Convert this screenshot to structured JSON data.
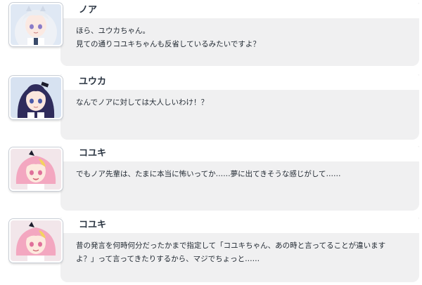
{
  "messages": [
    {
      "speaker": "ノア",
      "lines": [
        "ほら、ユウカちゃん。",
        "見ての通りコユキちゃんも反省しているみたいですよ？"
      ],
      "avatar": "noa-portrait",
      "hair_color": "#e9edf3",
      "accent_color": "#b9c7e6"
    },
    {
      "speaker": "ユウカ",
      "lines": [
        "なんでノアに対しては大人しいわけ！？"
      ],
      "avatar": "yuuka-portrait",
      "hair_color": "#2f2c5c",
      "accent_color": "#5a5aa0"
    },
    {
      "speaker": "コユキ",
      "lines": [
        "でもノア先輩は、たまに本当に怖いってか……夢に出てきそうな感じがして……"
      ],
      "avatar": "koyuki-portrait",
      "hair_color": "#f3a7c0",
      "accent_color": "#f4d35e"
    },
    {
      "speaker": "コユキ",
      "lines": [
        "昔の発言を何時何分だったかまで指定して「コユキちゃん、あの時と言ってることが違います",
        "よ？」って言ってきたりするから、マジでちょっと……"
      ],
      "avatar": "koyuki-portrait",
      "hair_color": "#f3a7c0",
      "accent_color": "#f4d35e"
    }
  ],
  "colors": {
    "bubble_bg": "#f0f0f1",
    "name_bar_bg": "#ffffff",
    "text": "#222a33"
  }
}
